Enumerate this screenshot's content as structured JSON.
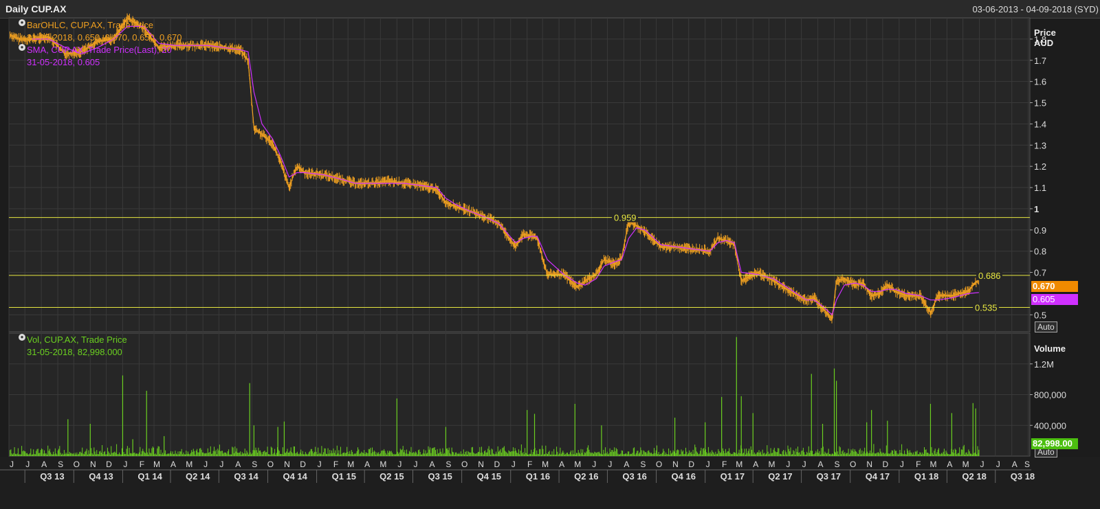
{
  "header": {
    "title": "Daily CUP.AX",
    "date_range": "03-06-2013 - 04-09-2018 (SYD)"
  },
  "legend": {
    "ohlc_title": "BarOHLC, CUP.AX, Trade Price",
    "ohlc_value": "31-05-2018, 0.650, 0.670, 0.650, 0.670",
    "sma_title": "SMA, CUP.AX, Trade Price(Last),  20",
    "sma_value": "31-05-2018, 0.605",
    "vol_title": "Vol, CUP.AX, Trade Price",
    "vol_value": "31-05-2018, 82,998.000"
  },
  "price_axis": {
    "title_line1": "Price",
    "title_line2": "AUD",
    "ticks": [
      "1.8",
      "1.7",
      "1.6",
      "1.5",
      "1.4",
      "1.3",
      "1.2",
      "1.1",
      "1",
      "0.9",
      "0.8",
      "0.7",
      "0.5"
    ],
    "tick_values": [
      1.8,
      1.7,
      1.6,
      1.5,
      1.4,
      1.3,
      1.2,
      1.1,
      1.0,
      0.9,
      0.8,
      0.7,
      0.5
    ],
    "auto_label": "Auto"
  },
  "volume_axis": {
    "title": "Volume",
    "ticks": [
      "1.2M",
      "800,000",
      "400,000"
    ],
    "tick_values": [
      1200000,
      800000,
      400000
    ],
    "auto_label": "Auto"
  },
  "tags": {
    "last_price": "0.670",
    "sma_price": "0.605",
    "last_volume": "82,998.00"
  },
  "colors": {
    "ohlc": "#f0a020",
    "sma": "#d030ff",
    "volume": "#6bd020",
    "hline": "#e8e840",
    "grid": "#3a3a3a"
  },
  "x_axis": {
    "months": [
      "J",
      "J",
      "A",
      "S",
      "O",
      "N",
      "D",
      "J",
      "F",
      "M",
      "A",
      "M",
      "J",
      "J",
      "A",
      "S",
      "O",
      "N",
      "D",
      "J",
      "F",
      "M",
      "A",
      "M",
      "J",
      "J",
      "A",
      "S",
      "O",
      "N",
      "D",
      "J",
      "F",
      "M",
      "A",
      "M",
      "J",
      "J",
      "A",
      "S",
      "O",
      "N",
      "D",
      "J",
      "F",
      "M",
      "A",
      "M",
      "J",
      "J",
      "A",
      "S",
      "O",
      "N",
      "D",
      "J",
      "F",
      "M",
      "A",
      "M",
      "J",
      "J",
      "A",
      "S"
    ],
    "quarters": [
      "Q3 13",
      "Q4 13",
      "Q1 14",
      "Q2 14",
      "Q3 14",
      "Q4 14",
      "Q1 15",
      "Q2 15",
      "Q3 15",
      "Q4 15",
      "Q1 16",
      "Q2 16",
      "Q3 16",
      "Q4 16",
      "Q1 17",
      "Q2 17",
      "Q3 17",
      "Q4 17",
      "Q1 18",
      "Q2 18",
      "Q3 18"
    ]
  },
  "chart_data": {
    "type": "line",
    "price_series": {
      "name": "CUP.AX",
      "x": [
        "2013-06-03",
        "2013-06-20",
        "2013-07-15",
        "2013-08-15",
        "2013-09-15",
        "2013-10-15",
        "2013-11-15",
        "2013-12-15",
        "2014-01-10",
        "2014-02-10",
        "2014-03-10",
        "2014-04-10",
        "2014-05-10",
        "2014-06-10",
        "2014-07-10",
        "2014-08-10",
        "2014-08-25",
        "2014-09-05",
        "2014-09-20",
        "2014-10-10",
        "2014-10-25",
        "2014-11-10",
        "2014-11-25",
        "2014-12-10",
        "2015-01-15",
        "2015-02-15",
        "2015-03-15",
        "2015-04-15",
        "2015-05-15",
        "2015-06-15",
        "2015-07-15",
        "2015-08-15",
        "2015-09-01",
        "2015-09-20",
        "2015-10-15",
        "2015-11-15",
        "2015-12-10",
        "2016-01-10",
        "2016-01-25",
        "2016-02-10",
        "2016-02-20",
        "2016-03-10",
        "2016-04-10",
        "2016-05-05",
        "2016-05-20",
        "2016-06-10",
        "2016-06-25",
        "2016-07-15",
        "2016-07-28",
        "2016-08-10",
        "2016-08-25",
        "2016-09-10",
        "2016-10-10",
        "2016-11-10",
        "2016-12-10",
        "2017-01-10",
        "2017-01-25",
        "2017-02-10",
        "2017-02-25",
        "2017-03-10",
        "2017-04-10",
        "2017-05-10",
        "2017-06-10",
        "2017-07-10",
        "2017-07-25",
        "2017-08-10",
        "2017-08-28",
        "2017-09-05",
        "2017-09-20",
        "2017-10-10",
        "2017-10-25",
        "2017-11-10",
        "2017-11-25",
        "2017-12-10",
        "2017-12-25",
        "2018-01-15",
        "2018-02-10",
        "2018-03-01",
        "2018-03-15",
        "2018-04-10",
        "2018-05-10",
        "2018-05-31"
      ],
      "close": [
        1.82,
        1.8,
        1.8,
        1.81,
        1.73,
        1.74,
        1.79,
        1.8,
        1.9,
        1.85,
        1.76,
        1.77,
        1.77,
        1.77,
        1.76,
        1.75,
        1.7,
        1.38,
        1.35,
        1.31,
        1.22,
        1.1,
        1.2,
        1.17,
        1.16,
        1.14,
        1.12,
        1.12,
        1.13,
        1.12,
        1.11,
        1.09,
        1.03,
        1.01,
        0.99,
        0.96,
        0.93,
        0.82,
        0.88,
        0.87,
        0.86,
        0.69,
        0.69,
        0.63,
        0.66,
        0.69,
        0.76,
        0.74,
        0.77,
        0.94,
        0.92,
        0.89,
        0.82,
        0.82,
        0.81,
        0.8,
        0.86,
        0.85,
        0.83,
        0.66,
        0.7,
        0.66,
        0.61,
        0.57,
        0.58,
        0.53,
        0.48,
        0.66,
        0.67,
        0.64,
        0.65,
        0.59,
        0.6,
        0.64,
        0.61,
        0.59,
        0.59,
        0.51,
        0.59,
        0.59,
        0.61,
        0.67
      ],
      "sma20": [
        null,
        null,
        1.8,
        1.8,
        1.76,
        1.73,
        1.76,
        1.8,
        1.86,
        1.86,
        1.78,
        1.77,
        1.77,
        1.77,
        1.76,
        1.75,
        1.74,
        1.55,
        1.4,
        1.33,
        1.25,
        1.15,
        1.17,
        1.17,
        1.16,
        1.14,
        1.12,
        1.12,
        1.12,
        1.12,
        1.11,
        1.1,
        1.05,
        1.02,
        0.99,
        0.96,
        0.93,
        0.84,
        0.86,
        0.87,
        0.87,
        0.76,
        0.69,
        0.65,
        0.64,
        0.67,
        0.73,
        0.75,
        0.76,
        0.86,
        0.91,
        0.9,
        0.83,
        0.82,
        0.81,
        0.8,
        0.84,
        0.85,
        0.84,
        0.7,
        0.69,
        0.67,
        0.62,
        0.57,
        0.57,
        0.54,
        0.5,
        0.57,
        0.64,
        0.65,
        0.64,
        0.61,
        0.61,
        0.62,
        0.62,
        0.6,
        0.59,
        0.57,
        0.57,
        0.58,
        0.6,
        0.605
      ]
    },
    "horizontal_lines": [
      {
        "value": 0.959,
        "label": "0.959"
      },
      {
        "value": 0.686,
        "label": "0.686"
      },
      {
        "value": 0.535,
        "label": "0.535"
      }
    ],
    "volume_series": {
      "name": "Vol, CUP.AX, Trade Price",
      "spikes": [
        {
          "x": "2013-09-20",
          "v": 480000
        },
        {
          "x": "2013-11-01",
          "v": 420000
        },
        {
          "x": "2014-01-01",
          "v": 1050000
        },
        {
          "x": "2014-01-20",
          "v": 220000
        },
        {
          "x": "2014-02-15",
          "v": 850000
        },
        {
          "x": "2014-03-20",
          "v": 260000
        },
        {
          "x": "2014-08-28",
          "v": 950000
        },
        {
          "x": "2014-09-05",
          "v": 400000
        },
        {
          "x": "2014-10-20",
          "v": 380000
        },
        {
          "x": "2014-11-01",
          "v": 450000
        },
        {
          "x": "2015-06-01",
          "v": 750000
        },
        {
          "x": "2015-09-01",
          "v": 380000
        },
        {
          "x": "2016-02-01",
          "v": 600000
        },
        {
          "x": "2016-02-15",
          "v": 550000
        },
        {
          "x": "2016-05-01",
          "v": 680000
        },
        {
          "x": "2016-06-20",
          "v": 400000
        },
        {
          "x": "2016-11-05",
          "v": 500000
        },
        {
          "x": "2017-01-01",
          "v": 440000
        },
        {
          "x": "2017-02-01",
          "v": 770000
        },
        {
          "x": "2017-03-01",
          "v": 1550000
        },
        {
          "x": "2017-03-10",
          "v": 780000
        },
        {
          "x": "2017-04-01",
          "v": 560000
        },
        {
          "x": "2017-07-20",
          "v": 1070000
        },
        {
          "x": "2017-08-10",
          "v": 420000
        },
        {
          "x": "2017-09-01",
          "v": 1140000
        },
        {
          "x": "2017-09-05",
          "v": 980000
        },
        {
          "x": "2017-11-01",
          "v": 440000
        },
        {
          "x": "2017-11-10",
          "v": 600000
        },
        {
          "x": "2017-12-10",
          "v": 460000
        },
        {
          "x": "2018-03-01",
          "v": 680000
        },
        {
          "x": "2018-04-10",
          "v": 560000
        },
        {
          "x": "2018-05-20",
          "v": 690000
        },
        {
          "x": "2018-05-25",
          "v": 620000
        },
        {
          "x": "2018-05-31",
          "v": 82998
        }
      ]
    },
    "ylim_price": [
      0.42,
      1.9
    ],
    "ylim_volume": [
      0,
      1600000
    ],
    "xlim": [
      "2013-06-01",
      "2018-09-04"
    ]
  }
}
